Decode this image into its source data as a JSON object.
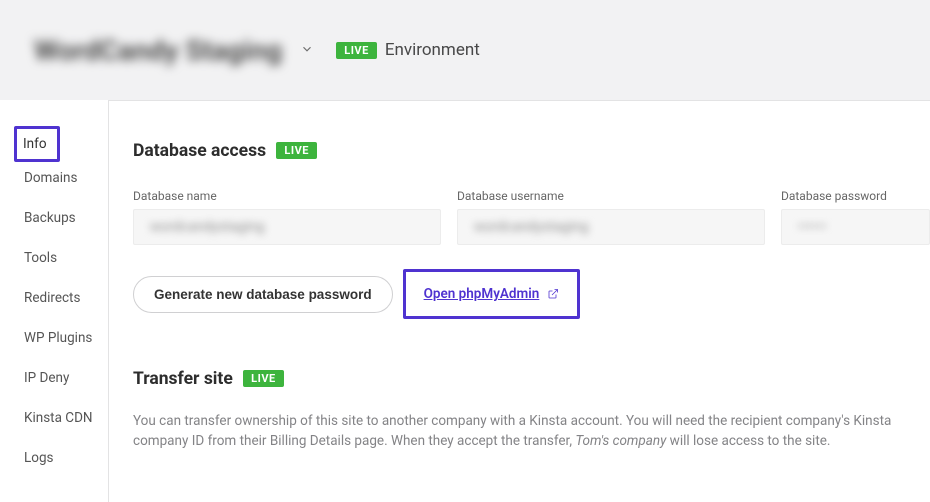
{
  "header": {
    "site_name": "WordCandy Staging",
    "badge": "LIVE",
    "env_text": "Environment"
  },
  "sidebar": {
    "items": [
      {
        "label": "Info"
      },
      {
        "label": "Domains"
      },
      {
        "label": "Backups"
      },
      {
        "label": "Tools"
      },
      {
        "label": "Redirects"
      },
      {
        "label": "WP Plugins"
      },
      {
        "label": "IP Deny"
      },
      {
        "label": "Kinsta CDN"
      },
      {
        "label": "Logs"
      }
    ]
  },
  "db": {
    "title": "Database access",
    "badge": "LIVE",
    "name_label": "Database name",
    "name_value": "wordcandystaging",
    "user_label": "Database username",
    "user_value": "wordcandystaging",
    "pass_label": "Database password",
    "pass_value": "••••••",
    "gen_btn": "Generate new database password",
    "open_link": "Open phpMyAdmin"
  },
  "transfer": {
    "title": "Transfer site",
    "badge": "LIVE",
    "desc_1": "You can transfer ownership of this site to another company with a Kinsta account. You will need the recipient company's Kinsta company ID from their Billing Details page. When they accept the transfer, ",
    "desc_em": "Tom's company",
    "desc_2": " will lose access to the site."
  }
}
